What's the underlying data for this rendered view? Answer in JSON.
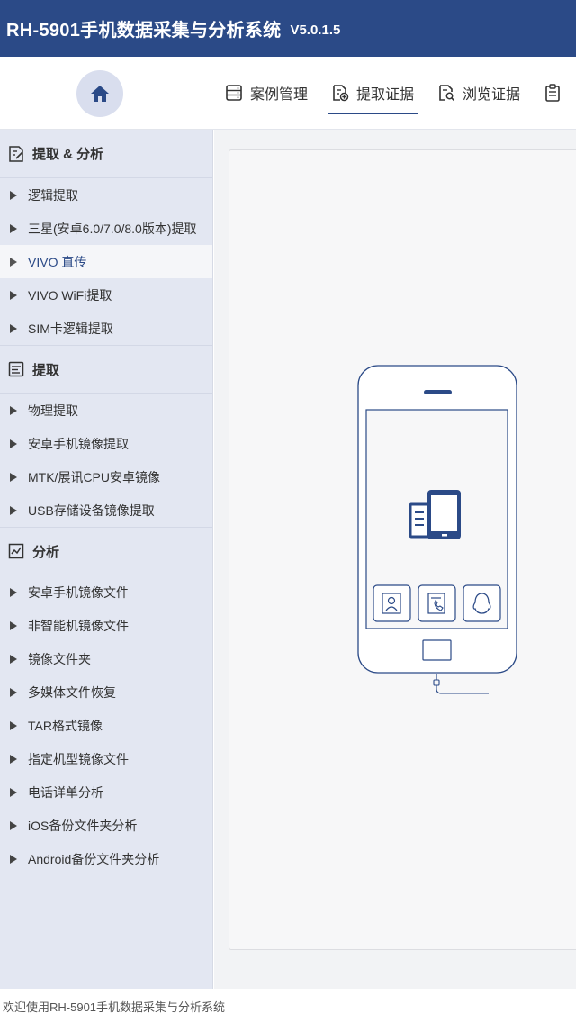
{
  "window": {
    "app_name": "RH-5901手机数据采集与分析系统",
    "version": "V5.0.1.5"
  },
  "toolbar": {
    "home_icon": "home-icon",
    "tabs": [
      {
        "label": "案例管理",
        "icon": "case-list-icon"
      },
      {
        "label": "提取证据",
        "icon": "extract-evidence-icon"
      },
      {
        "label": "浏览证据",
        "icon": "browse-evidence-icon"
      },
      {
        "label": "",
        "icon": "clipboard-icon"
      }
    ],
    "active_tab": "提取证据"
  },
  "sidebar": {
    "sections": [
      {
        "title": "提取 & 分析",
        "icon": "extract-analyze-icon",
        "items": [
          "逻辑提取",
          "三星(安卓6.0/7.0/8.0版本)提取",
          "VIVO 直传",
          "VIVO WiFi提取",
          "SIM卡逻辑提取"
        ]
      },
      {
        "title": "提取",
        "icon": "extract-icon",
        "items": [
          "物理提取",
          "安卓手机镜像提取",
          "MTK/展讯CPU安卓镜像",
          "USB存储设备镜像提取"
        ]
      },
      {
        "title": "分析",
        "icon": "analyze-icon",
        "items": [
          "安卓手机镜像文件",
          "非智能机镜像文件",
          "镜像文件夹",
          "多媒体文件恢复",
          "TAR格式镜像",
          "指定机型镜像文件",
          "电话详单分析",
          "iOS备份文件夹分析",
          "Android备份文件夹分析"
        ]
      }
    ],
    "selected_item": "VIVO 直传"
  },
  "main": {
    "illustration": "phone-device-icon",
    "illustration_icons": [
      "contacts-icon",
      "call-log-icon",
      "qq-icon"
    ]
  },
  "colors": {
    "primary": "#2b4a87",
    "sidebar_bg": "#e3e7f2",
    "content_bg": "#f2f3f5"
  },
  "status": {
    "message": "欢迎使用RH-5901手机数据采集与分析系统"
  }
}
